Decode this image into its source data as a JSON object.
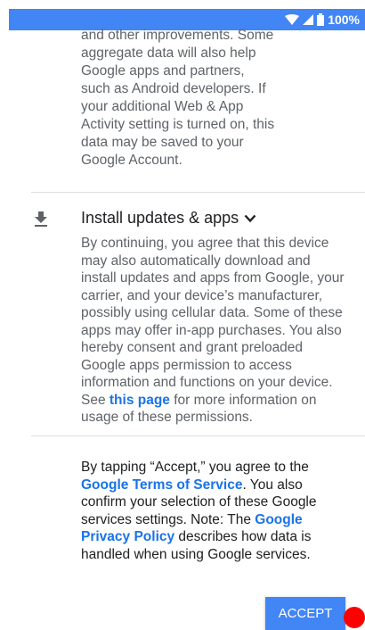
{
  "status_bar": {
    "battery_text": "100%",
    "background": "#4285f4",
    "icons": [
      "wifi-icon",
      "cell-signal-icon",
      "battery-icon"
    ]
  },
  "intro": {
    "text": "and other improvements. Some aggregate data will also help Google apps and partners, such as Android developers. If your additional Web & App Activity setting is turned on, this data may be saved to your Google Account."
  },
  "updates_section": {
    "icon": "download-icon",
    "heading": "Install updates & apps",
    "expand_icon": "chevron-down-icon",
    "body_part1": "By continuing, you agree that this device may also automatically download and install updates and apps from Google, your carrier, and your device’s manufacturer, possibly using cellular data. Some of these apps may offer in-app purchases. You also hereby consent and grant preloaded Google apps permission to access information and functions on your device. See ",
    "link_text": "this page",
    "body_part2": " for more information on usage of these permissions."
  },
  "consent": {
    "part1": "By tapping “Accept,” you agree to the ",
    "terms_link": "Google Terms of Service",
    "part2": ". You also confirm your selection of these Google services settings. Note: The ",
    "privacy_link": "Google Privacy Policy",
    "part3": " describes how data is handled when using Google services."
  },
  "accept_button": {
    "label": "ACCEPT",
    "color": "#4285f4"
  },
  "link_color": "#1a73e8"
}
